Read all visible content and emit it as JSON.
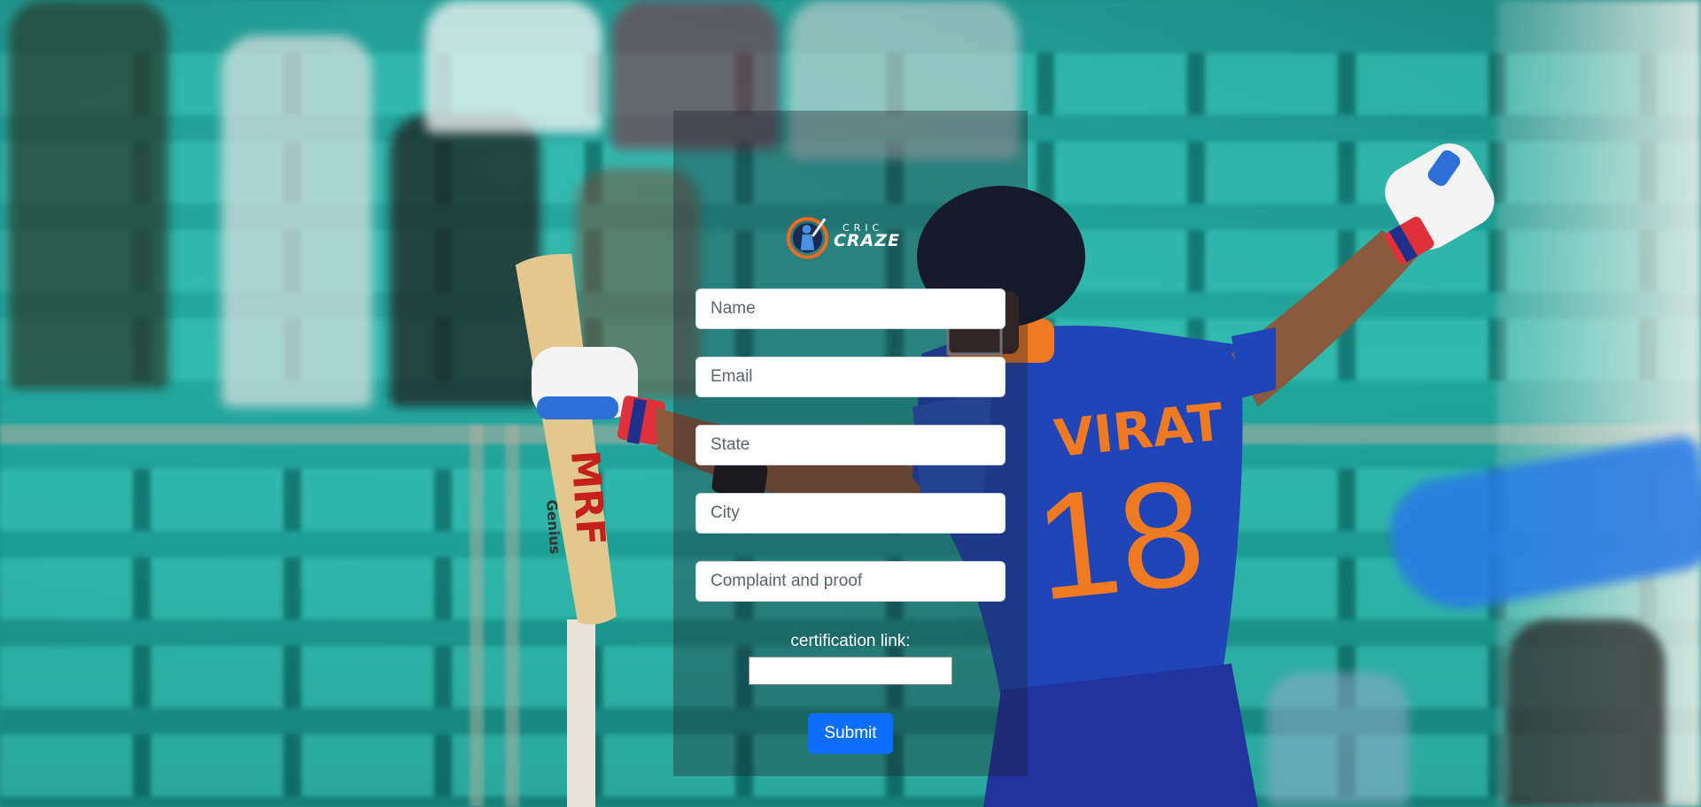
{
  "brand": {
    "logo_top": "CRIC",
    "logo_bottom": "CRAZE"
  },
  "background": {
    "jersey_name": "VIRAT",
    "jersey_number": "18",
    "bat_text": "MRF",
    "bat_model": "Genius"
  },
  "form": {
    "name": {
      "placeholder": "Name",
      "value": ""
    },
    "email": {
      "placeholder": "Email",
      "value": ""
    },
    "state": {
      "placeholder": "State",
      "value": ""
    },
    "city": {
      "placeholder": "City",
      "value": ""
    },
    "complaint": {
      "placeholder": "Complaint and proof",
      "value": ""
    },
    "certification_label": "certification link:",
    "certification_value": "",
    "submit_label": "Submit"
  },
  "colors": {
    "primary": "#0d6efd",
    "panel_overlay": "rgba(30,30,40,0.35)",
    "stadium_seats": "#22a79d",
    "jersey_blue": "#1f45b8",
    "jersey_orange": "#f07a22"
  }
}
